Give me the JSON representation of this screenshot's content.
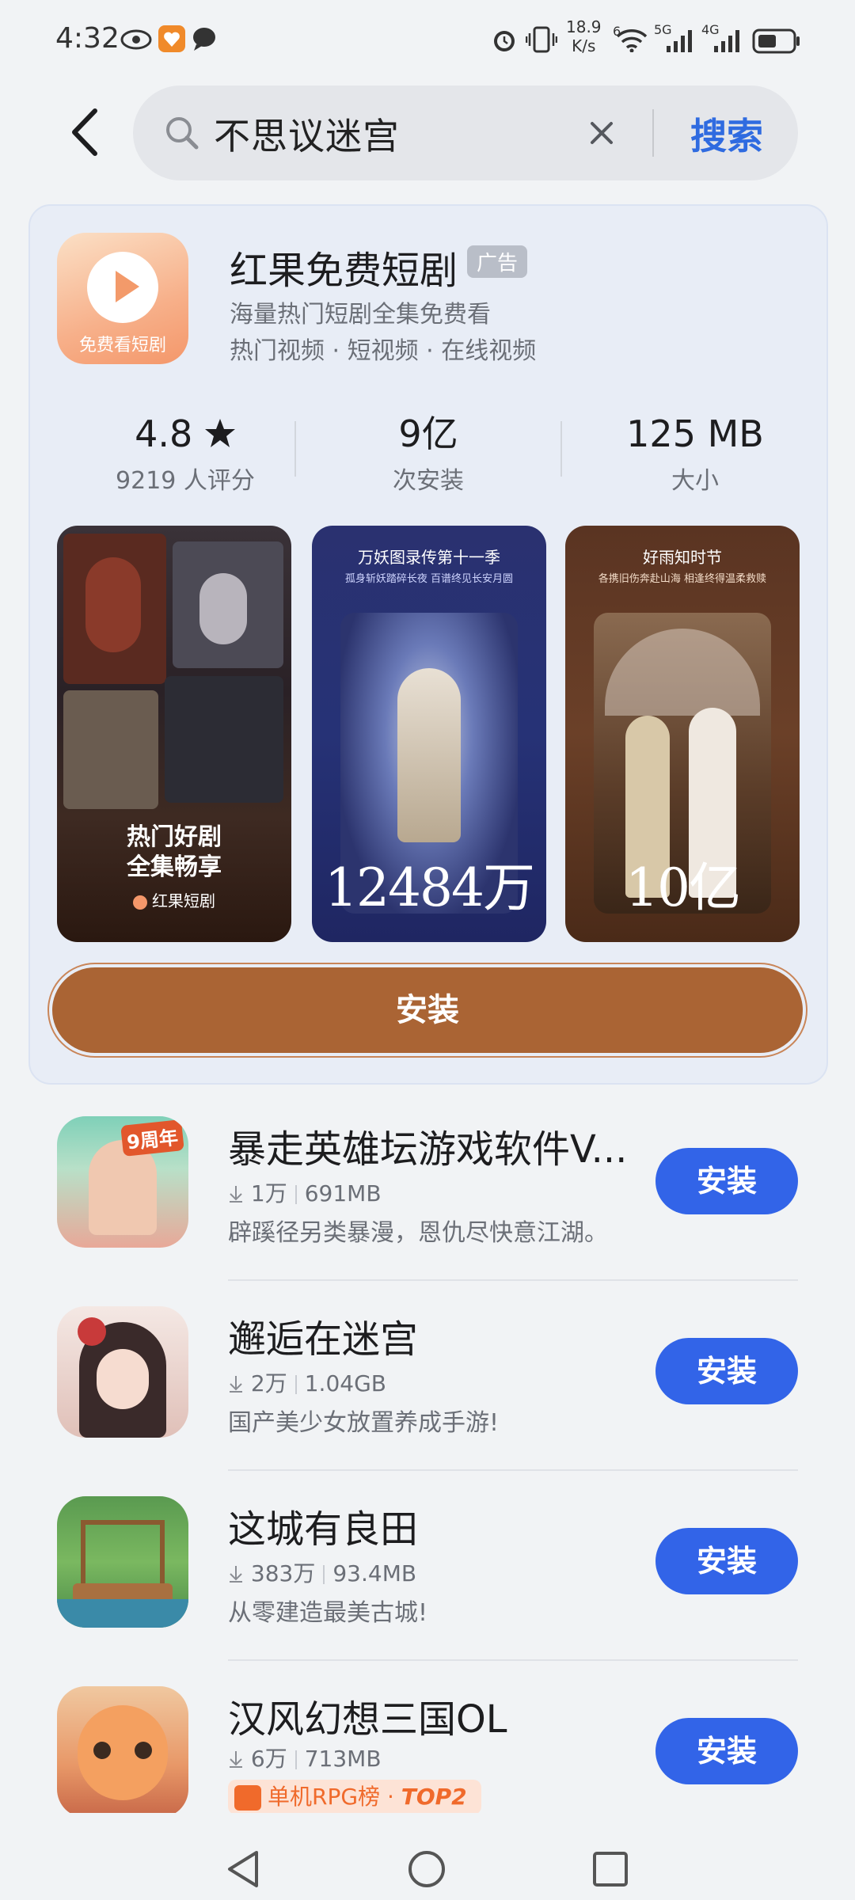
{
  "status_bar": {
    "time": "4:32",
    "speed_value": "18.9",
    "speed_unit": "K/s",
    "signal_a_label": "5G",
    "signal_b_label": "4G",
    "wifi_num": "6"
  },
  "search": {
    "query": "不思议迷宫",
    "submit_label": "搜索"
  },
  "ad_card": {
    "app_name": "红果免费短剧",
    "ad_badge": "广告",
    "icon_text": "免费看短剧",
    "description": "海量热门短剧全集免费看",
    "tags": "热门视频 · 短视频 · 在线视频",
    "rating": "4.8",
    "rating_label": "9219 人评分",
    "installs": "9亿",
    "installs_label": "次安装",
    "size": "125 MB",
    "size_label": "大小",
    "screenshots": [
      {
        "line1": "热门好剧",
        "line2": "全集畅享",
        "brand": "红果短剧"
      },
      {
        "title": "万妖图录传第十一季",
        "subtitle": "孤身斩妖踏碎长夜 百谱终见长安月圆",
        "big": "12484万"
      },
      {
        "title": "好雨知时节",
        "subtitle": "各携旧伤奔赴山海 相逢终得温柔救赎",
        "big": "10亿"
      }
    ],
    "install_label": "安装"
  },
  "results": [
    {
      "name": "暴走英雄坛游戏软件V...",
      "downloads": "1万",
      "size": "691MB",
      "desc": "辟蹊径另类暴漫，恩仇尽快意江湖。",
      "button": "安装",
      "icon_badge": "9周年"
    },
    {
      "name": "邂逅在迷宫",
      "downloads": "2万",
      "size": "1.04GB",
      "desc": "国产美少女放置养成手游!",
      "button": "安装"
    },
    {
      "name": "这城有良田",
      "downloads": "383万",
      "size": "93.4MB",
      "desc": "从零建造最美古城!",
      "button": "安装"
    },
    {
      "name": "汉风幻想三国OL",
      "downloads": "6万",
      "size": "713MB",
      "rank_label": "单机RPG榜 · ",
      "rank_top": "TOP2",
      "button": "安装"
    }
  ],
  "colors": {
    "accent_blue": "#3264e8",
    "link_blue": "#2f6be0",
    "ad_install": "#aa6434"
  }
}
